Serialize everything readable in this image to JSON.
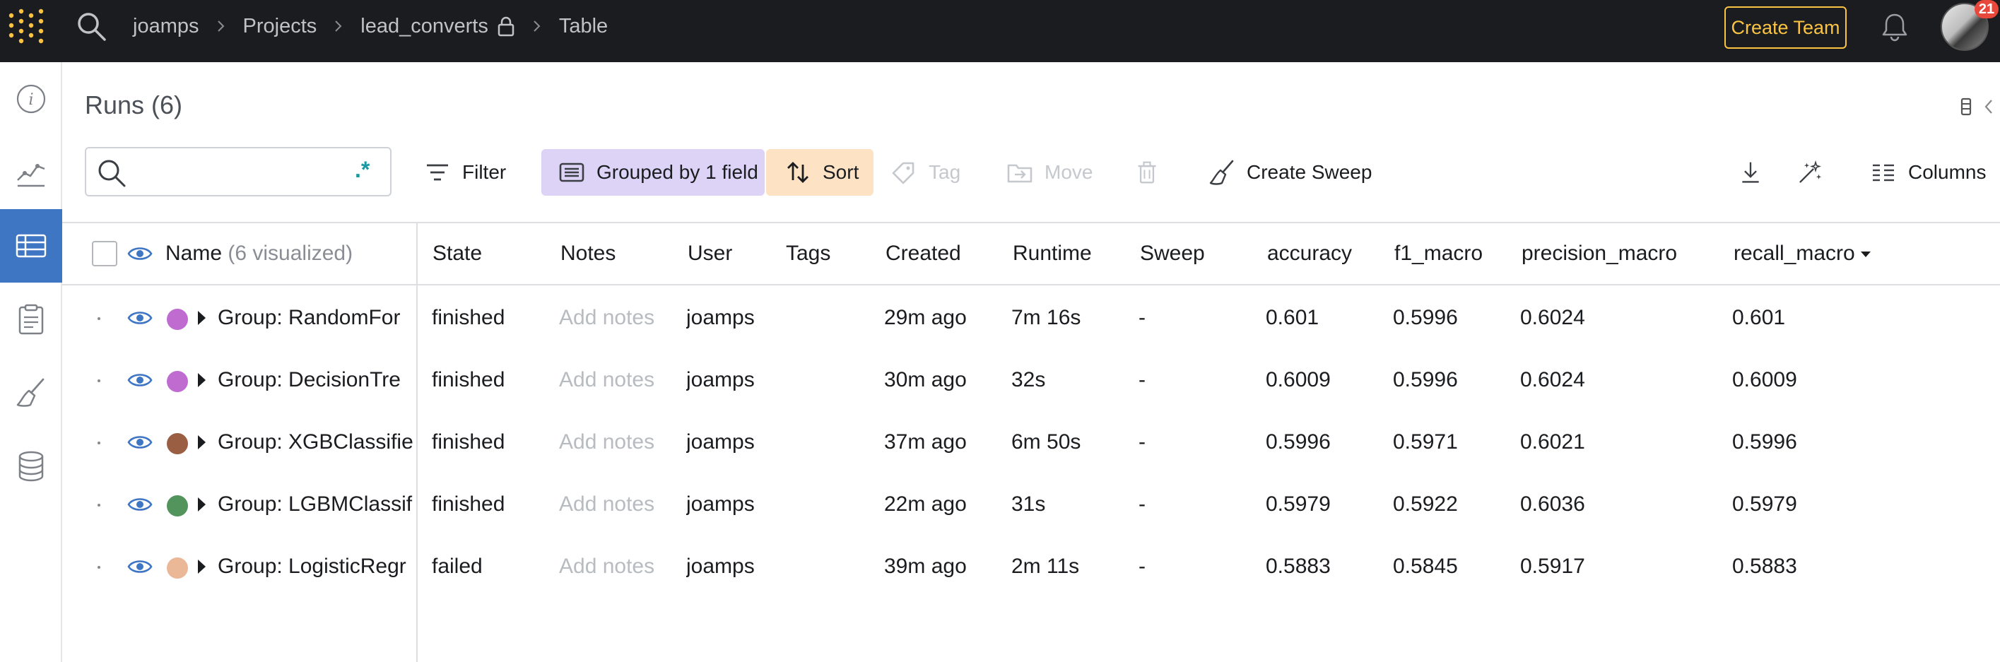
{
  "topbar": {
    "breadcrumbs": [
      "joamps",
      "Projects",
      "lead_converts",
      "Table"
    ],
    "create_team_label": "Create Team",
    "notification_count": "21"
  },
  "sidebar": {
    "items": [
      {
        "name": "info-icon"
      },
      {
        "name": "charts-icon"
      },
      {
        "name": "table-icon",
        "active": true
      },
      {
        "name": "reports-icon"
      },
      {
        "name": "sweeps-brush-icon"
      },
      {
        "name": "artifacts-database-icon"
      }
    ]
  },
  "runs": {
    "title": "Runs (6)",
    "search_placeholder": "",
    "regex_label": ".*"
  },
  "toolbar": {
    "filter_label": "Filter",
    "grouped_label": "Grouped by 1 field",
    "sort_label": "Sort",
    "tag_label": "Tag",
    "move_label": "Move",
    "create_sweep_label": "Create Sweep",
    "columns_label": "Columns"
  },
  "table": {
    "headers": {
      "name": "Name",
      "name_suffix": "(6 visualized)",
      "state": "State",
      "notes": "Notes",
      "user": "User",
      "tags": "Tags",
      "created": "Created",
      "runtime": "Runtime",
      "sweep": "Sweep",
      "accuracy": "accuracy",
      "f1_macro": "f1_macro",
      "precision_macro": "precision_macro",
      "recall_macro": "recall_macro"
    },
    "rows": [
      {
        "name": "Group: RandomFor",
        "color": "#c06bd0",
        "state": "finished",
        "notes": "Add notes",
        "user": "joamps",
        "tags": "",
        "created": "29m ago",
        "runtime": "7m 16s",
        "sweep": "-",
        "accuracy": "0.601",
        "f1_macro": "0.5996",
        "precision_macro": "0.6024",
        "recall_macro": "0.601"
      },
      {
        "name": "Group: DecisionTre",
        "color": "#c06bd0",
        "state": "finished",
        "notes": "Add notes",
        "user": "joamps",
        "tags": "",
        "created": "30m ago",
        "runtime": "32s",
        "sweep": "-",
        "accuracy": "0.6009",
        "f1_macro": "0.5996",
        "precision_macro": "0.6024",
        "recall_macro": "0.6009"
      },
      {
        "name": "Group: XGBClassifie",
        "color": "#9a5e43",
        "state": "finished",
        "notes": "Add notes",
        "user": "joamps",
        "tags": "",
        "created": "37m ago",
        "runtime": "6m 50s",
        "sweep": "-",
        "accuracy": "0.5996",
        "f1_macro": "0.5971",
        "precision_macro": "0.6021",
        "recall_macro": "0.5996"
      },
      {
        "name": "Group: LGBMClassif",
        "color": "#53945d",
        "state": "finished",
        "notes": "Add notes",
        "user": "joamps",
        "tags": "",
        "created": "22m ago",
        "runtime": "31s",
        "sweep": "-",
        "accuracy": "0.5979",
        "f1_macro": "0.5922",
        "precision_macro": "0.6036",
        "recall_macro": "0.5979"
      },
      {
        "name": "Group: LogisticRegr",
        "color": "#eab896",
        "state": "failed",
        "notes": "Add notes",
        "user": "joamps",
        "tags": "",
        "created": "39m ago",
        "runtime": "2m 11s",
        "sweep": "-",
        "accuracy": "0.5883",
        "f1_macro": "0.5845",
        "precision_macro": "0.5917",
        "recall_macro": "0.5883"
      }
    ]
  },
  "colors": {
    "topbar_bg": "#1a1c1f",
    "accent_yellow": "#fbc342",
    "active_nav": "#3f76c4",
    "grouped_bg": "#dcd3f7",
    "sort_bg": "#fde3c4",
    "eye_blue": "#3f76c4"
  }
}
